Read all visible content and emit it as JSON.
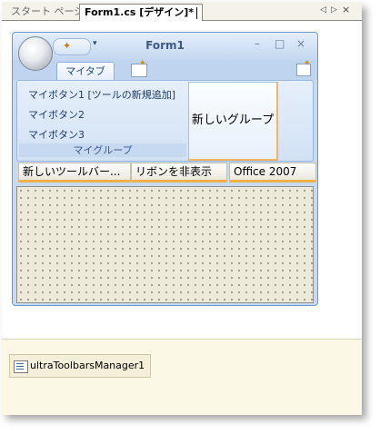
{
  "doc_tabs": {
    "start_page": "スタート ページ",
    "form1_design": "Form1.cs [デザイン]*"
  },
  "nav": {
    "left": "◁",
    "right": "▷",
    "close": "×"
  },
  "form": {
    "title": "Form1",
    "qat_menu": "▾",
    "min": "–",
    "max": "□",
    "close": "×"
  },
  "ribbon": {
    "tab_label": "マイタブ",
    "group_my": {
      "buttons": [
        "マイボタン1 [ツールの新規追加]",
        "マイボタン2",
        "マイボタン3"
      ],
      "caption": "マイグループ"
    },
    "group_new_label": "新しいグループ"
  },
  "toolbars": [
    "新しいツールバー...",
    "リボンを非表示",
    "Office 2007"
  ],
  "tray": {
    "component": "ultraToolbarsManager1"
  },
  "colors": {
    "ribbon_bg": "#c6dbf2",
    "accent_orange": "#f0b04a",
    "tray_bg": "#fcf8e6"
  }
}
